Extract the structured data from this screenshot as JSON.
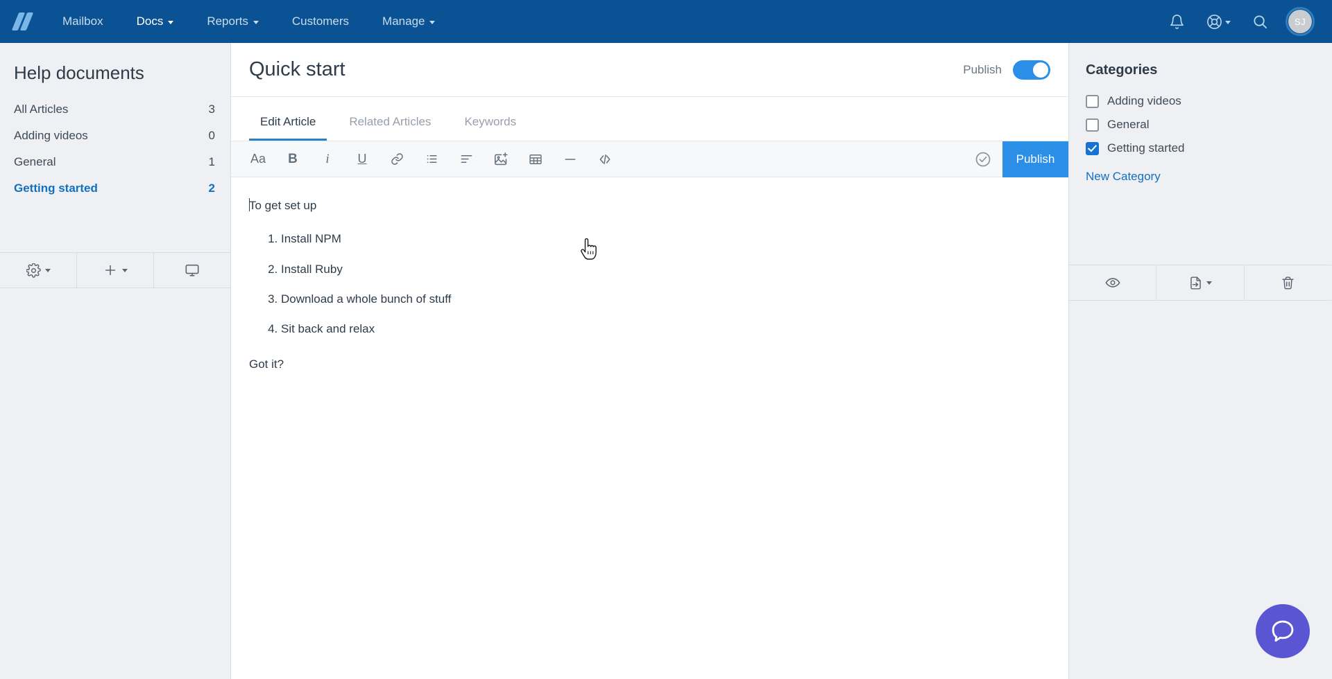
{
  "topnav": {
    "logo_name": "helpscout-logo",
    "items": [
      {
        "label": "Mailbox",
        "has_caret": false,
        "active": false
      },
      {
        "label": "Docs",
        "has_caret": true,
        "active": true
      },
      {
        "label": "Reports",
        "has_caret": true,
        "active": false
      },
      {
        "label": "Customers",
        "has_caret": false,
        "active": false
      },
      {
        "label": "Manage",
        "has_caret": true,
        "active": false
      }
    ],
    "icons": {
      "notifications": "bell-icon",
      "help": "life-ring-icon",
      "search": "search-icon"
    },
    "avatar_initials": "SJ",
    "background_color": "#0a5293"
  },
  "sidebar": {
    "title": "Help documents",
    "items": [
      {
        "label": "All Articles",
        "count": "3",
        "selected": false
      },
      {
        "label": "Adding videos",
        "count": "0",
        "selected": false
      },
      {
        "label": "General",
        "count": "1",
        "selected": false
      },
      {
        "label": "Getting started",
        "count": "2",
        "selected": true
      }
    ],
    "footer_buttons": [
      {
        "icon": "gear-icon",
        "has_caret": true
      },
      {
        "icon": "plus-icon",
        "has_caret": true
      },
      {
        "icon": "monitor-icon",
        "has_caret": false
      }
    ]
  },
  "document": {
    "title": "Quick start",
    "publish_label": "Publish",
    "publish_toggle_on": true,
    "tabs": [
      {
        "label": "Edit Article",
        "active": true
      },
      {
        "label": "Related Articles",
        "active": false
      },
      {
        "label": "Keywords",
        "active": false
      }
    ],
    "toolbar": {
      "tools": [
        {
          "icon": "font-size-icon",
          "glyph": "Aa"
        },
        {
          "icon": "bold-icon",
          "glyph": "B"
        },
        {
          "icon": "italic-icon",
          "glyph": "i"
        },
        {
          "icon": "underline-icon",
          "glyph": "U"
        },
        {
          "icon": "link-icon",
          "glyph": ""
        },
        {
          "icon": "bullet-list-icon",
          "glyph": ""
        },
        {
          "icon": "align-left-icon",
          "glyph": ""
        },
        {
          "icon": "add-image-icon",
          "glyph": ""
        },
        {
          "icon": "table-icon",
          "glyph": ""
        },
        {
          "icon": "horizontal-rule-icon",
          "glyph": ""
        },
        {
          "icon": "code-icon",
          "glyph": ""
        }
      ],
      "saved_icon": "check-circle-icon",
      "publish_button_label": "Publish",
      "publish_button_color": "#2b8fe8"
    },
    "content": {
      "intro": "To get set up",
      "steps": [
        "Install NPM",
        "Install Ruby",
        "Download a whole bunch of stuff",
        "Sit back and relax"
      ],
      "closing": "Got it?"
    }
  },
  "right_panel": {
    "title": "Categories",
    "categories": [
      {
        "label": "Adding videos",
        "checked": false
      },
      {
        "label": "General",
        "checked": false
      },
      {
        "label": "Getting started",
        "checked": true
      }
    ],
    "new_category_label": "New Category",
    "new_category_color": "#1270c0",
    "footer_buttons": [
      {
        "icon": "eye-icon",
        "has_caret": false
      },
      {
        "icon": "move-article-icon",
        "has_caret": true
      },
      {
        "icon": "trash-icon",
        "has_caret": false
      }
    ]
  },
  "beacon": {
    "icon": "chat-bubble-icon",
    "color": "#5955d3"
  }
}
